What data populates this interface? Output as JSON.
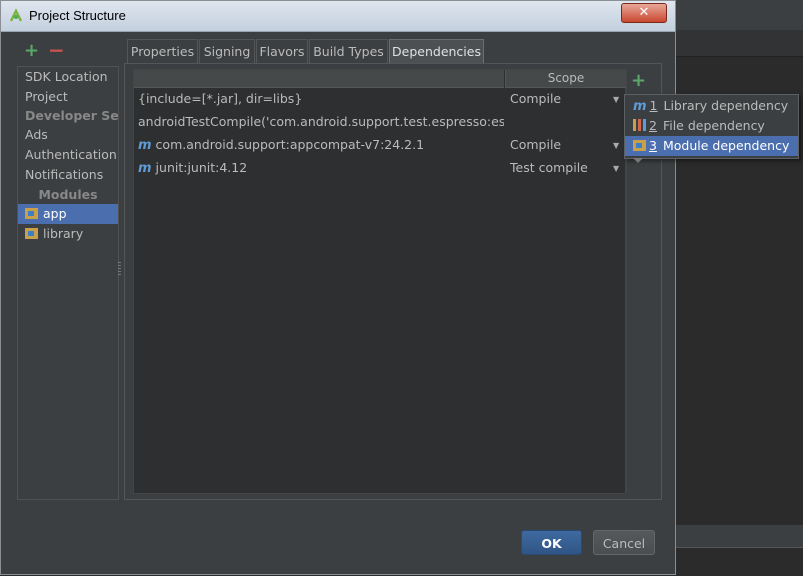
{
  "window": {
    "title": "Project Structure",
    "close_label": "✕"
  },
  "toolbar": {
    "add_symbol": "+",
    "remove_symbol": "−"
  },
  "sidebar": {
    "items": [
      {
        "label": "SDK Location"
      },
      {
        "label": "Project"
      },
      {
        "label": "Developer Ser..."
      },
      {
        "label": "Ads"
      },
      {
        "label": "Authentication"
      },
      {
        "label": "Notifications"
      },
      {
        "label": "Modules"
      },
      {
        "label": "app"
      },
      {
        "label": "library"
      }
    ]
  },
  "tabs": [
    {
      "label": "Properties"
    },
    {
      "label": "Signing"
    },
    {
      "label": "Flavors"
    },
    {
      "label": "Build Types"
    },
    {
      "label": "Dependencies"
    }
  ],
  "table": {
    "scope_header": "Scope",
    "rows": [
      {
        "name": "{include=[*.jar], dir=libs}",
        "scope": "Compile",
        "icon": "none"
      },
      {
        "name": "androidTestCompile('com.android.support.test.espresso:espres",
        "scope": "",
        "icon": "none"
      },
      {
        "name": "com.android.support:appcompat-v7:24.2.1",
        "scope": "Compile",
        "icon": "maven-icon"
      },
      {
        "name": "junit:junit:4.12",
        "scope": "Test compile",
        "icon": "maven-icon"
      }
    ],
    "maven_glyph": "m"
  },
  "add_dependency": {
    "plus_symbol": "+"
  },
  "popup": {
    "items": [
      {
        "num": "1",
        "label": "Library dependency",
        "icon": "library-icon"
      },
      {
        "num": "2",
        "label": "File dependency",
        "icon": "file-icon"
      },
      {
        "num": "3",
        "label": "Module dependency",
        "icon": "module-icon"
      }
    ]
  },
  "buttons": {
    "ok": "OK",
    "cancel": "Cancel"
  }
}
